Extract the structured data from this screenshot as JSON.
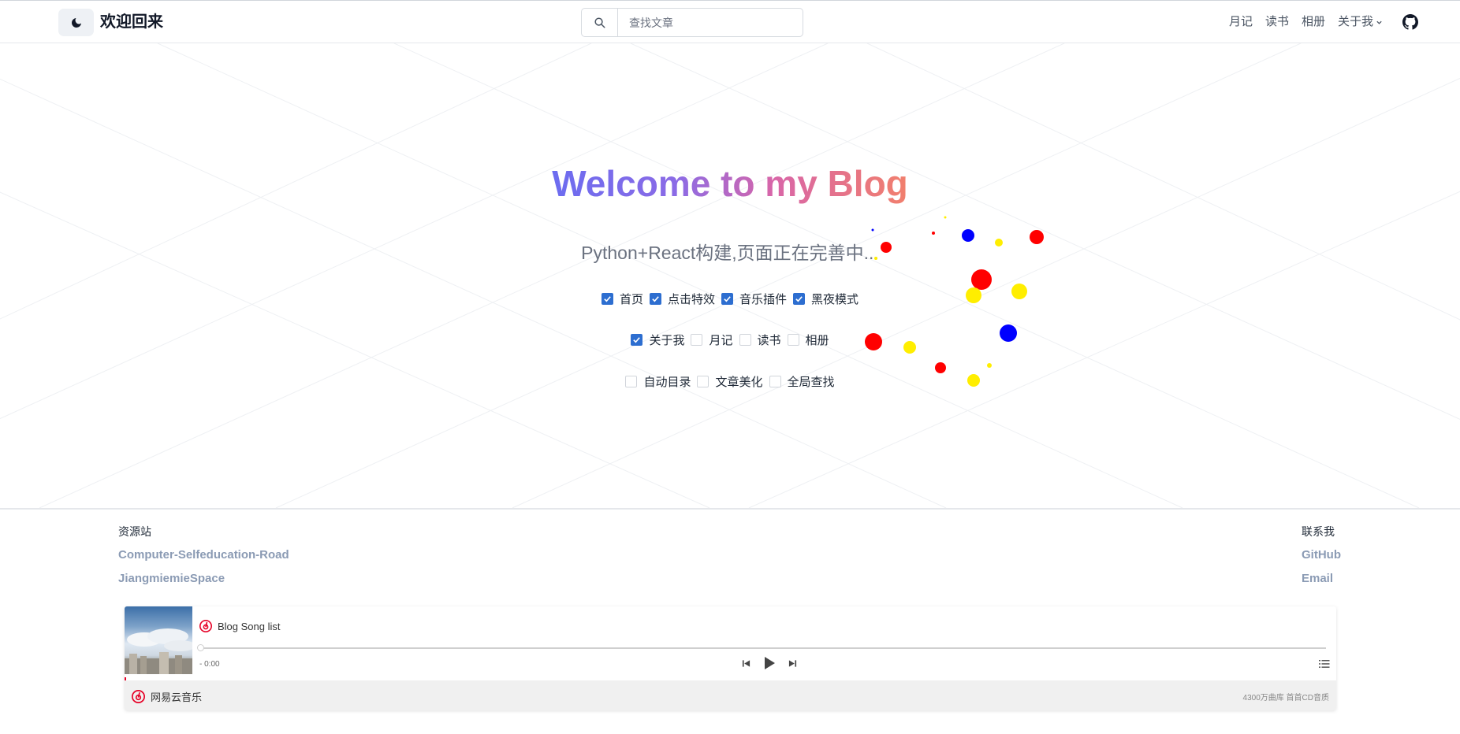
{
  "header": {
    "brand": "欢迎回来",
    "search_placeholder": "查找文章",
    "nav": [
      "月记",
      "读书",
      "相册"
    ],
    "nav_dropdown": "关于我"
  },
  "hero": {
    "title": "Welcome to my Blog",
    "subtitle": "Python+React构建,页面正在完善中..."
  },
  "options": {
    "row1": [
      {
        "label": "首页",
        "checked": true
      },
      {
        "label": "点击特效",
        "checked": true
      },
      {
        "label": "音乐插件",
        "checked": true
      },
      {
        "label": "黑夜模式",
        "checked": true
      }
    ],
    "row2": [
      {
        "label": "关于我",
        "checked": true
      },
      {
        "label": "月记",
        "checked": false
      },
      {
        "label": "读书",
        "checked": false
      },
      {
        "label": "相册",
        "checked": false
      }
    ],
    "row3": [
      {
        "label": "自动目录",
        "checked": false
      },
      {
        "label": "文章美化",
        "checked": false
      },
      {
        "label": "全局查找",
        "checked": false
      }
    ]
  },
  "footer": {
    "left": {
      "heading": "资源站",
      "links": [
        "Computer-Selfeducation-Road",
        "JiangmiemieSpace"
      ]
    },
    "right": {
      "heading": "联系我",
      "links": [
        "GitHub",
        "Email"
      ]
    }
  },
  "player": {
    "title": "Blog Song list",
    "time": "- 0:00",
    "brand": "网易云音乐",
    "tagline": "4300万曲库 首首CD音质",
    "progress": 0
  },
  "colors": {
    "accent": "#2d6ed0",
    "brand_red": "#e60026",
    "title_gradient": [
      "#6b6cf0",
      "#d866a8",
      "#f2806b"
    ]
  }
}
